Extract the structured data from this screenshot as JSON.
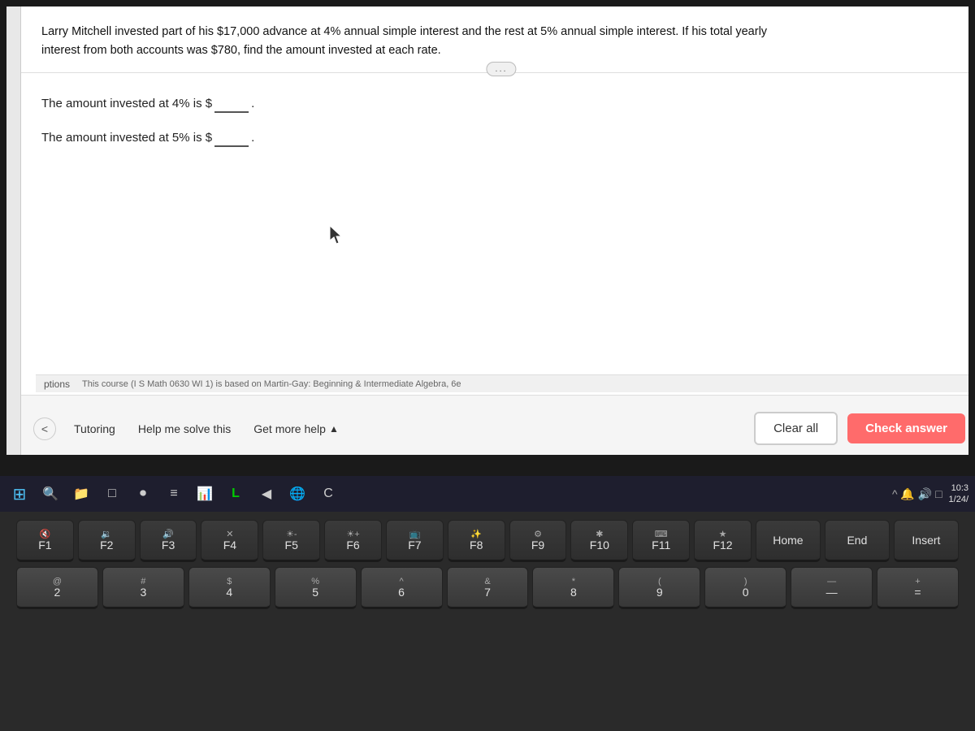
{
  "screen": {
    "problem": {
      "text_line1": "Larry Mitchell invested part of his $17,000 advance at 4% annual simple interest and the rest at 5% annual simple interest.  If his total yearly",
      "text_line2": "interest from both accounts was $780, find the amount invested at each rate."
    },
    "answer_fields": {
      "line1_prefix": "The amount invested at 4% is $",
      "line1_suffix": ".",
      "line2_prefix": "The amount invested at 5% is $",
      "line2_suffix": "."
    },
    "expand_button": "...",
    "footer_text": "This course (I S Math 0630 WI 1) is based on Martin-Gay: Beginning & Intermediate Algebra, 6e"
  },
  "toolbar": {
    "chevron": "<",
    "tutoring_label": "Tutoring",
    "help_label": "Help me solve this",
    "get_more_help_label": "Get more help",
    "get_more_help_arrow": "▲",
    "clear_label": "Clear all",
    "check_label": "Check answer",
    "ptions_label": "ptions"
  },
  "taskbar": {
    "time": "10:3",
    "date": "1/24/",
    "icons": [
      "⊞",
      "🔍",
      "📁",
      "□",
      "⏺",
      "≡",
      "📊",
      "L",
      "◀",
      "🌐",
      "C"
    ]
  },
  "keyboard": {
    "row1_label": "function keys row",
    "row2_label": "number row",
    "fn_keys": [
      "F1",
      "F2",
      "F3",
      "F4",
      "F5",
      "F6",
      "F7",
      "F8",
      "F9",
      "F10",
      "F11",
      "F12"
    ],
    "fn_icons": [
      "🔇",
      "🔉",
      "🔊",
      "✕",
      "☀-",
      "☀+",
      "📺",
      "✨",
      "⚙",
      "✱",
      "⌨",
      "★"
    ],
    "num_keys": [
      {
        "top": "@",
        "bottom": "2"
      },
      {
        "top": "#",
        "bottom": "3"
      },
      {
        "top": "$",
        "bottom": "4"
      },
      {
        "top": "%",
        "bottom": "5"
      },
      {
        "top": "^",
        "bottom": "6"
      },
      {
        "top": "&",
        "bottom": "7"
      },
      {
        "top": "*",
        "bottom": "8"
      },
      {
        "top": "(",
        "bottom": "9"
      },
      {
        "top": ")",
        "bottom": "0"
      },
      {
        "top": "—",
        "bottom": "—"
      },
      {
        "top": "+",
        "bottom": "="
      }
    ]
  }
}
